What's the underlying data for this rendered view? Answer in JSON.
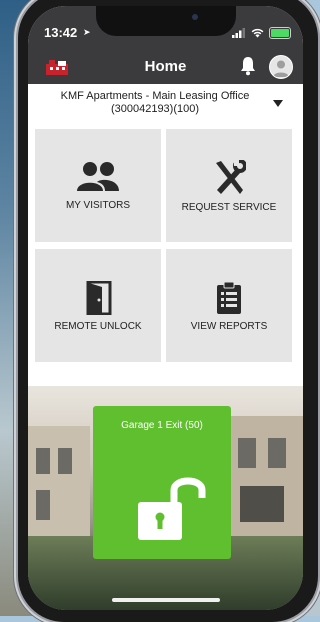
{
  "status_bar": {
    "time": "13:42"
  },
  "header": {
    "title": "Home"
  },
  "property": {
    "line1": "KMF Apartments - Main Leasing Office",
    "line2": "(300042193)(100)"
  },
  "tiles": [
    {
      "label": "MY VISITORS",
      "icon": "people-icon"
    },
    {
      "label": "REQUEST SERVICE",
      "icon": "tools-icon"
    },
    {
      "label": "REMOTE UNLOCK",
      "icon": "door-icon"
    },
    {
      "label": "VIEW REPORTS",
      "icon": "clipboard-icon"
    }
  ],
  "unlock": {
    "label": "Garage 1 Exit (50)",
    "icon": "unlocked-padlock-icon"
  },
  "colors": {
    "appbar": "#3b3b3d",
    "tile": "#e5e5e5",
    "unlock": "#5fbf2e",
    "logo_red": "#c8232c"
  }
}
